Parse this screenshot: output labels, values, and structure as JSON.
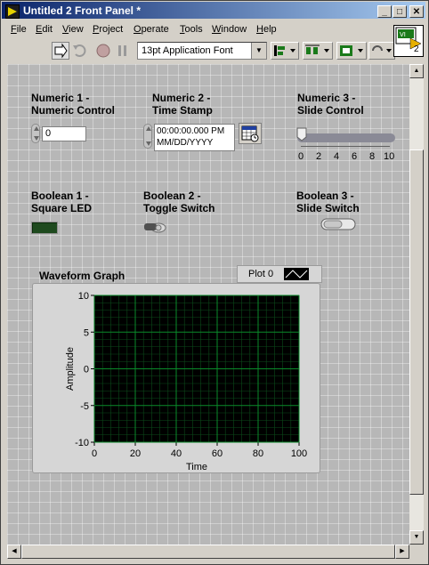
{
  "window": {
    "title": "Untitled 2 Front Panel *",
    "controls": [
      "_",
      "□",
      "✕"
    ]
  },
  "menu": [
    {
      "label": "File",
      "key": "F"
    },
    {
      "label": "Edit",
      "key": "E"
    },
    {
      "label": "View",
      "key": "V"
    },
    {
      "label": "Project",
      "key": "P"
    },
    {
      "label": "Operate",
      "key": "O"
    },
    {
      "label": "Tools",
      "key": "T"
    },
    {
      "label": "Window",
      "key": "W"
    },
    {
      "label": "Help",
      "key": "H"
    }
  ],
  "toolbar": {
    "font": "13pt Application Font",
    "connector_count": "2"
  },
  "controls": {
    "numeric1": {
      "label_line1": "Numeric 1 -",
      "label_line2": "Numeric Control",
      "value": "0"
    },
    "numeric2": {
      "label_line1": "Numeric 2 -",
      "label_line2": "Time Stamp",
      "time": "00:00:00.000 PM",
      "date": "MM/DD/YYYY"
    },
    "numeric3": {
      "label_line1": "Numeric 3 -",
      "label_line2": "Slide Control",
      "ticks": [
        "0",
        "2",
        "4",
        "6",
        "8",
        "10"
      ],
      "value": 0
    },
    "boolean1": {
      "label_line1": "Boolean 1 -",
      "label_line2": "Square LED"
    },
    "boolean2": {
      "label_line1": "Boolean 2  -",
      "label_line2": "Toggle Switch"
    },
    "boolean3": {
      "label_line1": "Boolean 3 -",
      "label_line2": "Slide Switch"
    }
  },
  "graph": {
    "title": "Waveform Graph",
    "legend": "Plot 0",
    "colors": {
      "plot_bg": "#000000",
      "grid": "#0a8a2a",
      "minor_grid": "#0b4a1a"
    }
  },
  "chart_data": {
    "type": "line",
    "title": "Waveform Graph",
    "xlabel": "Time",
    "ylabel": "Amplitude",
    "xlim": [
      0,
      100
    ],
    "ylim": [
      -10,
      10
    ],
    "xticks": [
      "0",
      "20",
      "40",
      "60",
      "80",
      "100"
    ],
    "yticks": [
      "10",
      "5",
      "0",
      "-5",
      "-10"
    ],
    "grid": true,
    "legend_position": "top-right",
    "series": [
      {
        "name": "Plot 0",
        "x": [],
        "y": []
      }
    ]
  }
}
